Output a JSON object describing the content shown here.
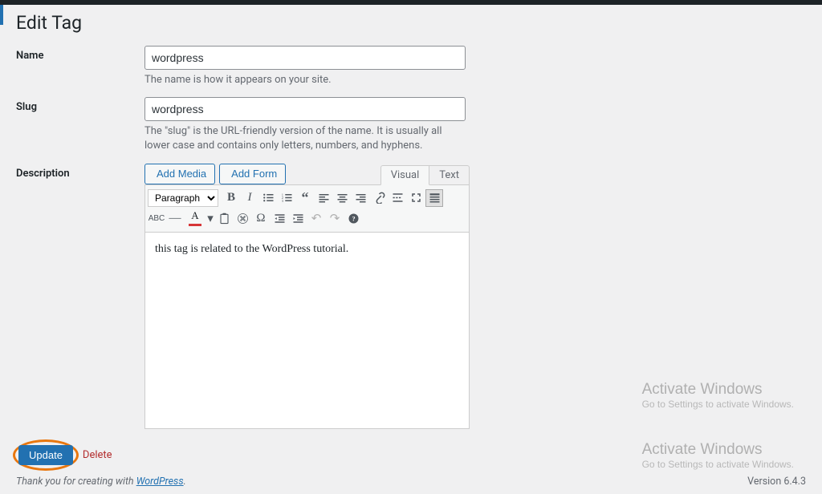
{
  "page": {
    "title": "Edit Tag"
  },
  "fields": {
    "name": {
      "label": "Name",
      "value": "wordpress",
      "help": "The name is how it appears on your site."
    },
    "slug": {
      "label": "Slug",
      "value": "wordpress",
      "help": "The \"slug\" is the URL-friendly version of the name. It is usually all lower case and contains only letters, numbers, and hyphens."
    },
    "description": {
      "label": "Description",
      "content": "this tag is related to the WordPress tutorial."
    }
  },
  "media_buttons": {
    "add_media": "Add Media",
    "add_form": "Add Form"
  },
  "editor_tabs": {
    "visual": "Visual",
    "text": "Text"
  },
  "toolbar": {
    "paragraph": "Paragraph"
  },
  "actions": {
    "update": "Update",
    "delete": "Delete"
  },
  "footer": {
    "credit_prefix": "Thank you for creating with ",
    "credit_link": "WordPress",
    "credit_suffix": ".",
    "version": "Version 6.4.3"
  },
  "watermark": {
    "title": "Activate Windows",
    "sub": "Go to Settings to activate Windows."
  }
}
